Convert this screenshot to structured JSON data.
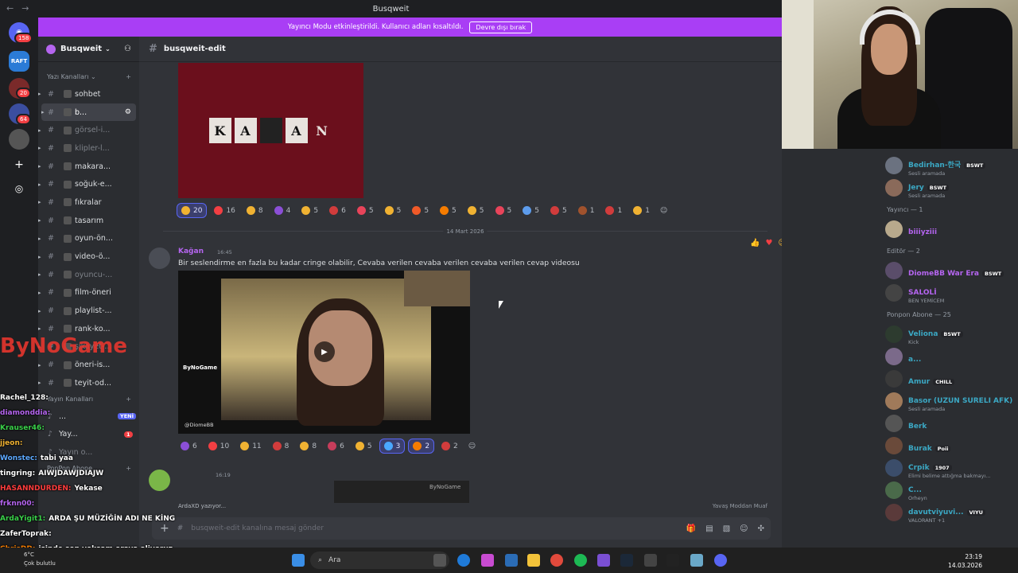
{
  "window": {
    "title": "Busqweit"
  },
  "banner": {
    "text": "Yayıncı Modu etkinleştirildi. Kullanıcı adları kısaltıldı.",
    "button": "Devre dışı bırak"
  },
  "servers": {
    "badges": [
      "158",
      "20",
      "64"
    ],
    "raft_label": "RAFT"
  },
  "guild": {
    "name": "Busqweit"
  },
  "sidebar": {
    "text_category": "Yazı Kanalları",
    "channels": [
      {
        "label": "sohbet",
        "color": "#dbdee1"
      },
      {
        "label": "b...",
        "color": "#ffffff"
      },
      {
        "label": "görsel-i...",
        "color": "#7e8289"
      },
      {
        "label": "klipler-l...",
        "color": "#7e8289"
      },
      {
        "label": "makara...",
        "color": "#dbdee1"
      },
      {
        "label": "soğuk-e...",
        "color": "#dbdee1"
      },
      {
        "label": "fıkralar",
        "color": "#dbdee1"
      },
      {
        "label": "tasarım",
        "color": "#dbdee1"
      },
      {
        "label": "oyun-ön...",
        "color": "#dbdee1"
      },
      {
        "label": "video-ö...",
        "color": "#dbdee1"
      },
      {
        "label": "oyuncu-...",
        "color": "#7e8289"
      },
      {
        "label": "film-öneri",
        "color": "#dbdee1"
      },
      {
        "label": "playlist-...",
        "color": "#dbdee1"
      },
      {
        "label": "rank-ko...",
        "color": "#dbdee1"
      },
      {
        "label": "şikayet-...",
        "color": "#7e8289"
      },
      {
        "label": "öneri-is...",
        "color": "#dbdee1"
      },
      {
        "label": "teyit-od...",
        "color": "#dbdee1"
      }
    ],
    "voice_category": "Yayın Kanalları",
    "voice_channels": [
      {
        "label": "...",
        "badge": "YENİ"
      },
      {
        "label": "Yay...",
        "badge": "1"
      },
      {
        "label": "Yayın o...",
        "badge": ""
      }
    ],
    "ponpon_category": "PonPon Abone"
  },
  "channel": {
    "name": "busqweit-edit"
  },
  "message_top": {
    "image_letters": [
      "K",
      "A",
      "",
      "A",
      "N"
    ],
    "reactions": [
      {
        "count": "20",
        "color": "#f0b232",
        "selected": true
      },
      {
        "count": "16",
        "color": "#f23f43"
      },
      {
        "count": "8",
        "color": "#f0b232"
      },
      {
        "count": "4",
        "color": "#8b4fd6"
      },
      {
        "count": "5",
        "color": "#f0b232"
      },
      {
        "count": "6",
        "color": "#d13c3c"
      },
      {
        "count": "5",
        "color": "#e8445a"
      },
      {
        "count": "5",
        "color": "#f0b232"
      },
      {
        "count": "5",
        "color": "#f05a28"
      },
      {
        "count": "5",
        "color": "#f57c00"
      },
      {
        "count": "5",
        "color": "#f0b232"
      },
      {
        "count": "5",
        "color": "#e8445a"
      },
      {
        "count": "5",
        "color": "#5d9cec"
      },
      {
        "count": "5",
        "color": "#d13c3c"
      },
      {
        "count": "1",
        "color": "#a0522d"
      },
      {
        "count": "1",
        "color": "#d13c3c"
      },
      {
        "count": "1",
        "color": "#f0b232"
      }
    ]
  },
  "date_divider": "14 Mart 2026",
  "message_main": {
    "author": "Kağan",
    "time": "16:45",
    "text": "Bir seslendirme en fazla bu kadar cringe olabilir, Cevaba verilen cevaba verilen cevaba verilen cevap videosu",
    "video_logo": "ByNoGame",
    "video_credit": "@DiomeBB",
    "reactions": [
      {
        "count": "6",
        "color": "#8b4fd6"
      },
      {
        "count": "10",
        "color": "#f23f43"
      },
      {
        "count": "11",
        "color": "#f0b232"
      },
      {
        "count": "8",
        "color": "#d13c3c"
      },
      {
        "count": "8",
        "color": "#f0b232"
      },
      {
        "count": "6",
        "color": "#c73d5b"
      },
      {
        "count": "5",
        "color": "#f0b232"
      },
      {
        "count": "3",
        "color": "#4aa8ff",
        "selected": true
      },
      {
        "count": "2",
        "color": "#f57c00",
        "selected": true
      },
      {
        "count": "2",
        "color": "#d13c3c"
      }
    ]
  },
  "message_next": {
    "time": "16:19",
    "logo": "ByNoGame"
  },
  "typing": "ArdaXD yazıyor...",
  "slow_mode": "Yavaş Moddan Muaf",
  "composer": {
    "placeholder": "busqweit-edit kanalına mesaj gönder"
  },
  "members": [
    {
      "name": "Bedirhan-한국",
      "sub": "Sesli aramada",
      "tag": "BSWT",
      "color": "#3ba8c4"
    },
    {
      "name": "Jery",
      "sub": "Sesli aramada",
      "tag": "BSWT",
      "color": "#3ba8c4"
    },
    {
      "role": "Yayıncı — 1"
    },
    {
      "name": "biiiyziii",
      "sub": "",
      "tag": "",
      "color": "#b565f0"
    },
    {
      "role": "Editör — 2"
    },
    {
      "name": "DiomeBB War Era",
      "sub": "",
      "tag": "BSWT",
      "color": "#b565f0"
    },
    {
      "name": "SALOLİ",
      "sub": "BEN YEMİCEM",
      "tag": "",
      "color": "#b565f0"
    },
    {
      "role": "Ponpon Abone — 25"
    },
    {
      "name": "Veliona",
      "sub": "Kick",
      "tag": "BSWT",
      "color": "#3ba8c4"
    },
    {
      "name": "a...",
      "sub": "",
      "tag": "",
      "color": "#3ba8c4"
    },
    {
      "name": "Amur",
      "sub": "",
      "tag": "CHILL",
      "color": "#3ba8c4"
    },
    {
      "name": "Basor (UZUN SURELI AFK)",
      "sub": "Sesli aramada",
      "tag": "",
      "color": "#3ba8c4"
    },
    {
      "name": "Berk",
      "sub": "",
      "tag": "",
      "color": "#3ba8c4"
    },
    {
      "name": "Burak",
      "sub": "",
      "tag": "Poii",
      "color": "#3ba8c4"
    },
    {
      "name": "Crpik",
      "sub": "Elimi belime attığma bakmayı...",
      "tag": "1907",
      "color": "#3ba8c4"
    },
    {
      "name": "C...",
      "sub": "Orheyn",
      "tag": "",
      "color": "#3ba8c4"
    },
    {
      "name": "davutviyuvi...",
      "sub": "VALORANT +1",
      "tag": "VIYU",
      "color": "#3ba8c4"
    }
  ],
  "stream_chat": [
    {
      "user": "Rachel_128:",
      "text": "",
      "color": "#ffffff"
    },
    {
      "user": "diamonddia:",
      "text": "",
      "color": "#b565f0"
    },
    {
      "user": "Krauser46:",
      "text": "",
      "color": "#3ad14a"
    },
    {
      "user": "jjeon:",
      "text": "",
      "color": "#f0b232"
    },
    {
      "user": "Wonstec:",
      "text": "tabi yaa",
      "color": "#5da9ff"
    },
    {
      "user": "tingring:",
      "text": "AIWJDAWJDIAJW",
      "color": "#ffffff"
    },
    {
      "user": "HASANNDURDEN:",
      "text": "Yekase",
      "color": "#ff3d3d"
    },
    {
      "user": "frknn00:",
      "text": "",
      "color": "#b565f0"
    },
    {
      "user": "ArdaYigit1:",
      "text": "ARDA ŞU MÜZİĞİN ADI NE KİNG",
      "color": "#3ad14a"
    },
    {
      "user": "ZaferToprak:",
      "text": "",
      "color": "#ffffff"
    },
    {
      "user": "ChrisDD:",
      "text": "işinde son yoksam oraya aliyoruz",
      "color": "#f57c00"
    }
  ],
  "stream_logo": "ByNoGame",
  "taskbar": {
    "weather_temp": "6°C",
    "weather_text": "Çok bulutlu",
    "search_label": "Ara",
    "time": "23:19",
    "date": "14.03.2026"
  }
}
